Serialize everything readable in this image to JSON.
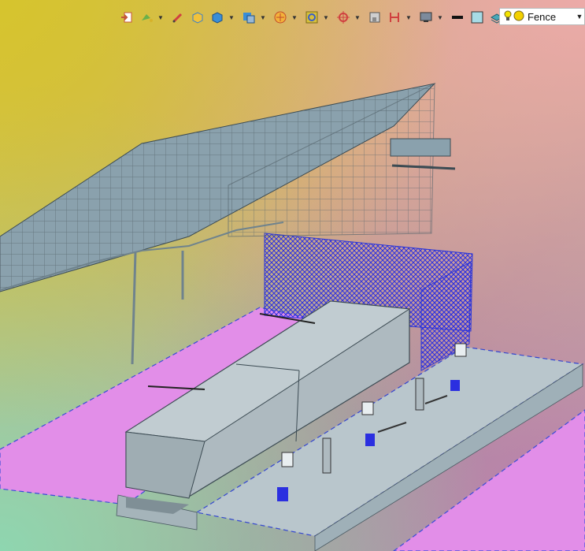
{
  "toolbar": {
    "items": [
      {
        "icon": "import-icon"
      },
      {
        "icon": "paint-bucket-icon",
        "dropdown": true
      },
      {
        "icon": "pencil-icon"
      },
      {
        "icon": "box-icon"
      },
      {
        "icon": "solid-cube-icon",
        "dropdown": true
      },
      {
        "icon": "view-cube-icon",
        "dropdown": true
      },
      {
        "icon": "orbit-icon",
        "dropdown": true
      },
      {
        "icon": "zoom-fit-icon",
        "dropdown": true
      },
      {
        "icon": "origin-axis-icon",
        "dropdown": true
      },
      {
        "icon": "frame-icon"
      },
      {
        "icon": "dimension-icon",
        "dropdown": true
      },
      {
        "icon": "monitor-icon",
        "dropdown": true
      },
      {
        "icon": "line-color-icon"
      },
      {
        "icon": "fill-color-icon"
      },
      {
        "icon": "layers-icon",
        "dropdown": true
      }
    ]
  },
  "layer": {
    "current": "Fence",
    "colors": {
      "bulb": "#f3e300",
      "dot": "#f3d000"
    }
  },
  "colors": {
    "structure": "#7f9aa8",
    "mesh": "#2a35d8",
    "platform": "#e48be8",
    "concrete": "#aab8bf"
  }
}
